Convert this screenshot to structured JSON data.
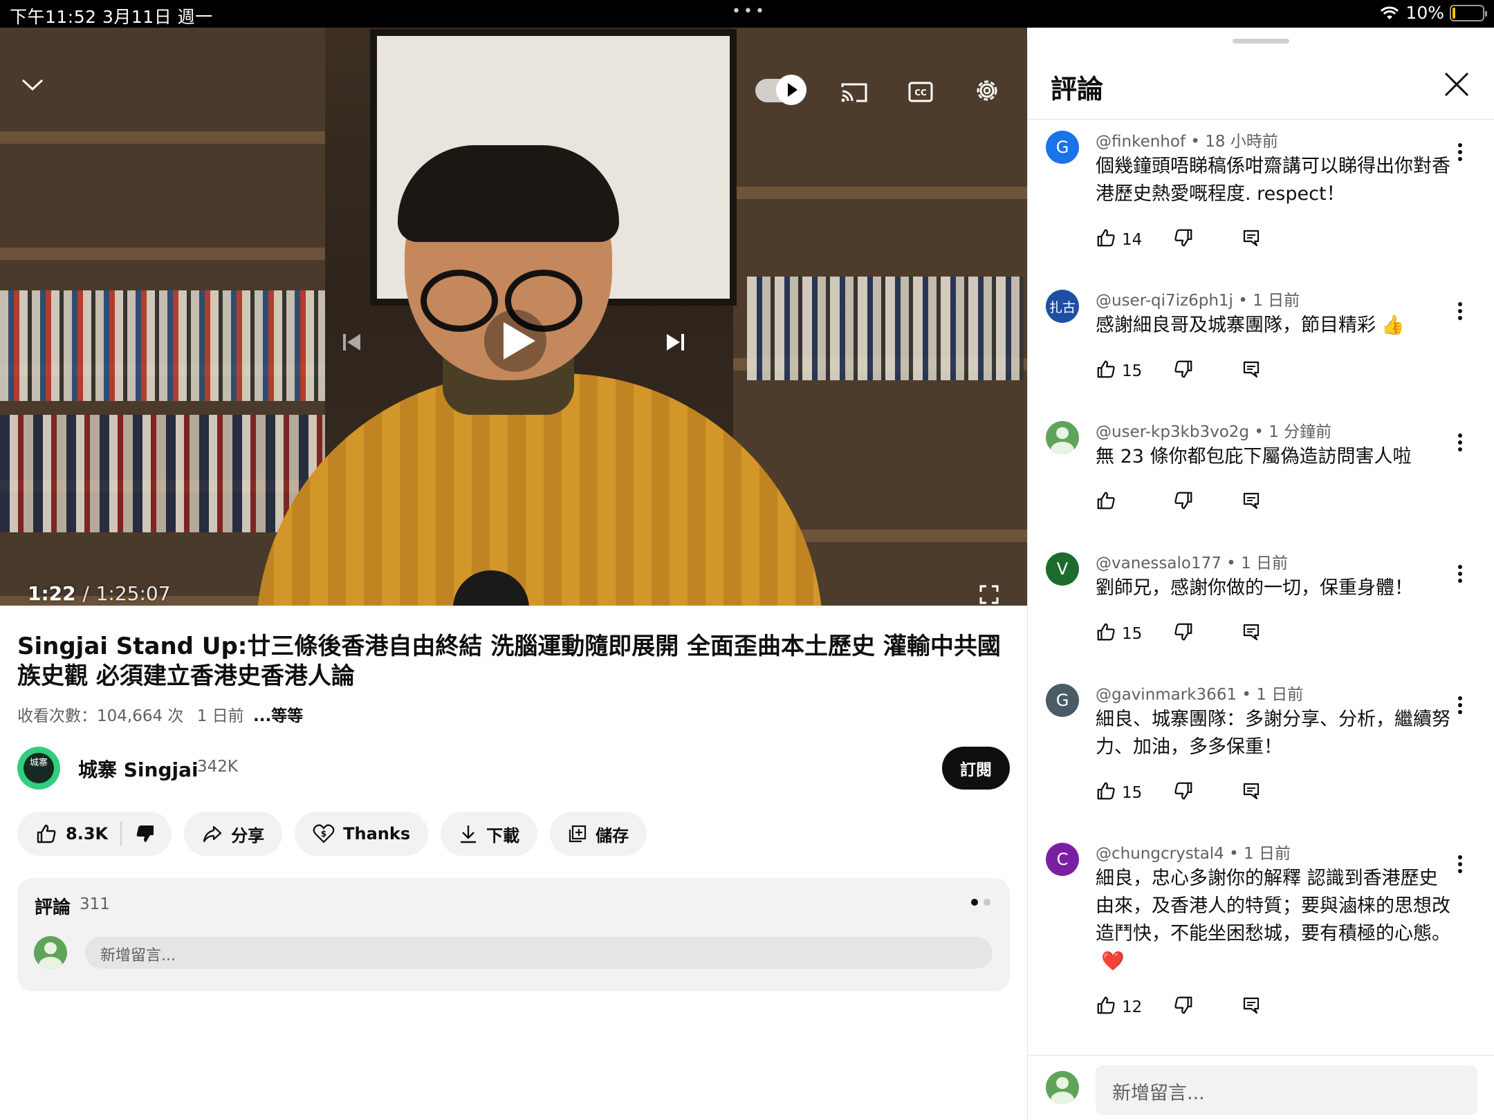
{
  "status_bar": {
    "time": "下午11:52  3月11日 週一",
    "dots": "•••",
    "battery": "10%",
    "battery_level": 0.1,
    "wifi_icon": "wifi-icon"
  },
  "player": {
    "current_time": "1:22",
    "separator": "/",
    "duration": "1:25:07",
    "progress_fraction": 0.016,
    "icons": [
      "chevron-down-icon",
      "autoplay-toggle",
      "cast-icon",
      "cc-icon",
      "gear-icon",
      "previous-icon",
      "play-icon",
      "next-icon",
      "fullscreen-icon"
    ]
  },
  "video": {
    "title": "Singjai Stand Up:廿三條後香港自由終結 洗腦運動隨即展開 全面歪曲本土歷史 灌輸中共國族史觀 必須建立香港史香港人論",
    "views": "收看次數：104,664 次",
    "age": "1 日前",
    "more": "...等等"
  },
  "channel": {
    "avatar_text": "城寨",
    "name": "城寨 Singjai",
    "subscribers": "342K",
    "subscribe_label": "訂閱"
  },
  "actions": {
    "likes": "8.3K",
    "share": "分享",
    "thanks": "Thanks",
    "download": "下載",
    "save": "儲存"
  },
  "comments_card": {
    "title": "評論",
    "count": "311",
    "placeholder": "新增留言..."
  },
  "panel": {
    "title": "評論",
    "input_placeholder": "新增留言..."
  },
  "comments": [
    {
      "initial": "G",
      "color": "#1a73e8",
      "author": "@finkenhof",
      "time": "18 小時前",
      "text": "個幾鐘頭唔睇稿係咁齋講可以睇得出你對香港歷史熱愛嘅程度. respect！",
      "emoji": "",
      "likes": "14"
    },
    {
      "initial": "扎古",
      "color": "#1f4fa3",
      "author": "@user-qi7iz6ph1j",
      "time": "1 日前",
      "text": "感謝細良哥及城寨團隊，節目精彩",
      "emoji": "👍",
      "likes": "15"
    },
    {
      "initial": "",
      "color": "#5fa45a",
      "author": "@user-kp3kb3vo2g",
      "time": "1 分鐘前",
      "text": "無 23 條你都包庇下屬偽造訪問害人啦",
      "emoji": "",
      "likes": ""
    },
    {
      "initial": "V",
      "color": "#1e6b2e",
      "author": "@vanessalo177",
      "time": "1 日前",
      "text": "劉師兄，感謝你做的一切，保重身體！",
      "emoji": "",
      "likes": "15"
    },
    {
      "initial": "G",
      "color": "#4a5b66",
      "author": "@gavinmark3661",
      "time": "1 日前",
      "text": "細良、城寨團隊：多謝分享、分析，繼續努力、加油，多多保重！",
      "emoji": "",
      "likes": "15"
    },
    {
      "initial": "C",
      "color": "#7b1fa2",
      "author": "@chungcrystal4",
      "time": "1 日前",
      "text": "細良，忠心多謝你的解釋 認識到香港歷史由來，及香港人的特質；要與滷梾的思想改造鬥快，不能坐困愁城，要有積極的心態。",
      "emoji": "❤️",
      "likes": "12"
    }
  ]
}
